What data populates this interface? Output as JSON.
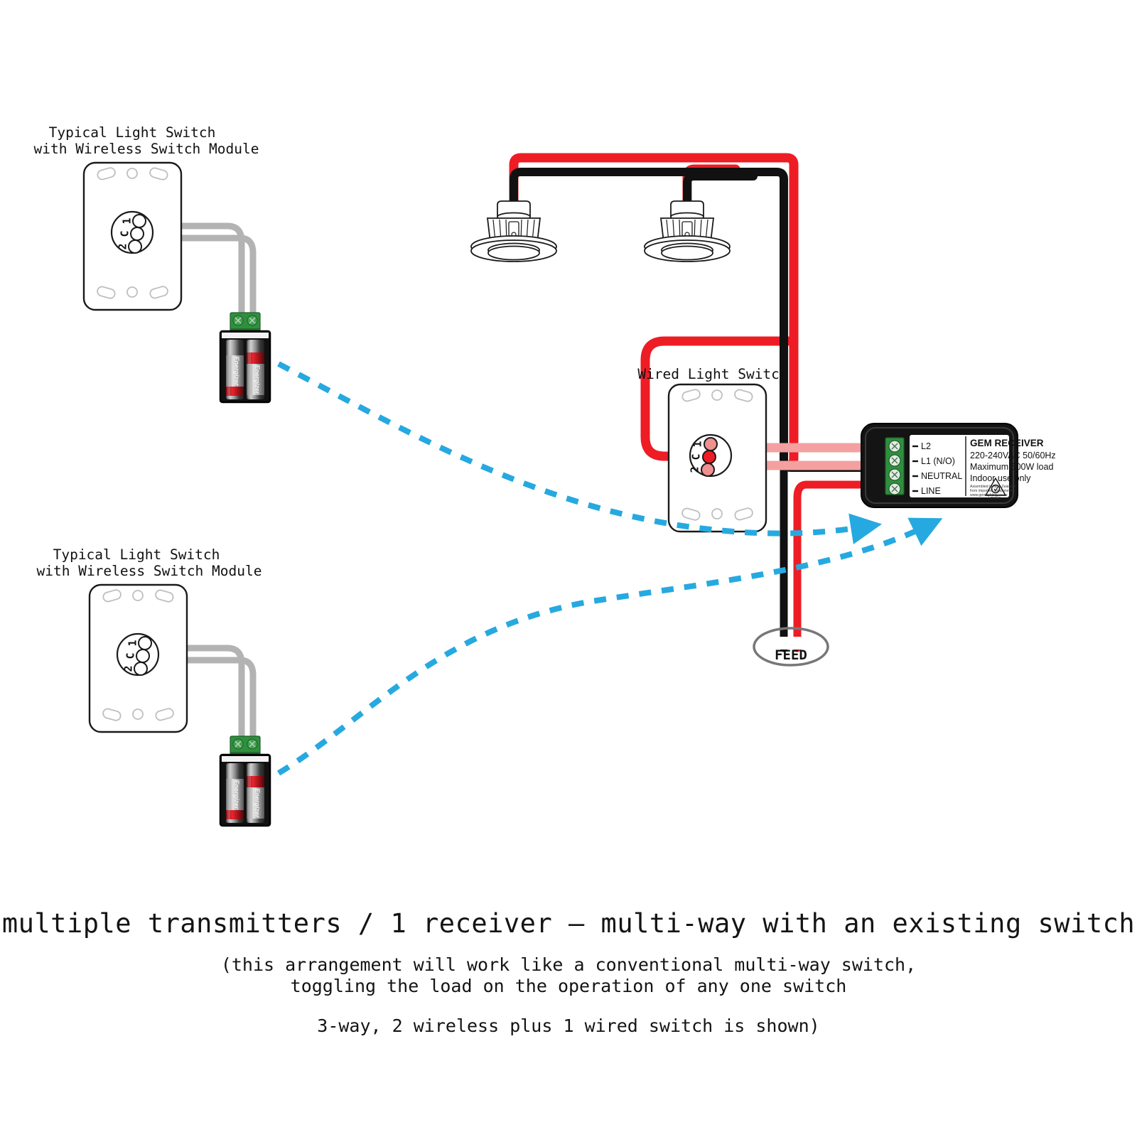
{
  "diagram": {
    "title": "multiple transmitters / 1 receiver – multi-way with an existing switch",
    "caption_line1": "(this arrangement will work like a conventional multi-way switch,",
    "caption_line2": "toggling the load on the operation of any one switch",
    "caption_line3": "3-way, 2 wireless plus 1 wired switch is shown)"
  },
  "colors": {
    "live_red": "#ee1c25",
    "neutral_black": "#111111",
    "switch_wire_pink": "#f4a0a0",
    "rf_blue": "#26a9e0",
    "module_wire_gray": "#b3b3b3",
    "receiver_body": "#1a1a1a",
    "terminal_green": "#2f8f3e",
    "feed_ring_gray": "#777777"
  },
  "transmitters": [
    {
      "id": "transmitter-top",
      "title_line1": "Typical Light Switch",
      "title_line2": "with Wireless Switch Module",
      "terminals": [
        "1",
        "C",
        "2"
      ],
      "battery_brand": "Energizer",
      "battery_count": 2
    },
    {
      "id": "transmitter-bottom",
      "title_line1": "Typical Light Switch",
      "title_line2": "with Wireless Switch Module",
      "terminals": [
        "1",
        "C",
        "2"
      ],
      "battery_brand": "Energizer",
      "battery_count": 2
    }
  ],
  "wired_switch": {
    "title": "Wired Light Switch",
    "terminals": [
      "1",
      "C",
      "2"
    ]
  },
  "receiver": {
    "name": "GEM RECEIVER",
    "spec_voltage": "220-240VAC 50/60Hz",
    "spec_load": "Maximum 500W load",
    "spec_use": "Indoor use only",
    "fineprint_line1": "Assembled in New Zealand",
    "fineprint_line2": "from imported components",
    "fineprint_line3": "www.gemlighting.co.nz",
    "compliance_code": "E5046",
    "compliance_mark": "RCM",
    "terminals": [
      "L2",
      "L1 (N/O)",
      "NEUTRAL",
      "LINE"
    ]
  },
  "feed": {
    "label": "FEED"
  },
  "luminaires": [
    {
      "id": "downlight-left",
      "type": "recessed-downlight"
    },
    {
      "id": "downlight-right",
      "type": "recessed-downlight"
    }
  ],
  "rf_links": [
    {
      "from": "transmitter-top",
      "to": "receiver"
    },
    {
      "from": "transmitter-bottom",
      "to": "receiver"
    }
  ]
}
